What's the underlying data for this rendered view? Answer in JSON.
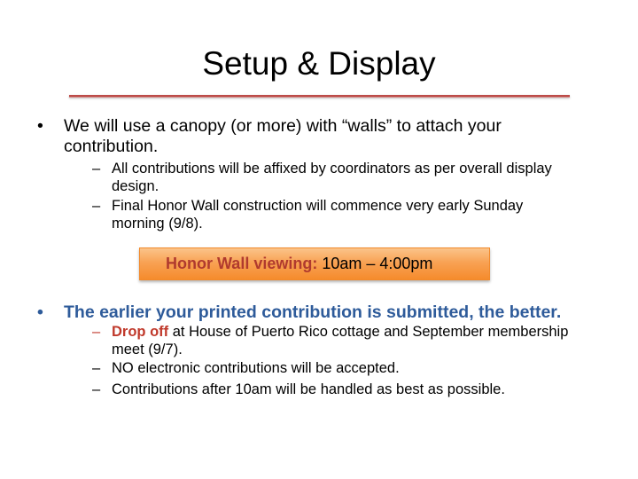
{
  "slide": {
    "title": "Setup & Display",
    "bullet_glyph": "•",
    "dash_glyph": "–",
    "items": [
      {
        "text_line1": "We will use a canopy (or more) with “walls” to attach your",
        "text_line2": "contribution."
      },
      {
        "text": "The earlier your printed contribution is submitted, the better."
      }
    ],
    "sub_items_1": [
      {
        "line1": "All contributions will be affixed by coordinators as per overall display",
        "line2": "design."
      },
      {
        "line1": "Final Honor Wall construction will commence very early Sunday",
        "line2": "morning (9/8)."
      }
    ],
    "callout": {
      "label": "Honor Wall viewing:",
      "value": " 10am – 4:00pm"
    },
    "sub_items_2": [
      {
        "highlight": "Drop off",
        "line1_rest": " at House of Puerto Rico cottage and September membership",
        "line2": "meet (9/7)."
      },
      {
        "text": "NO electronic contributions will be accepted."
      },
      {
        "text": "Contributions after 10am will be handled as best as possible."
      }
    ]
  },
  "colors": {
    "title_rule": "#c0504d",
    "blue_text": "#2e5b9a",
    "red_text": "#c0392b",
    "callout_fill": "#f8a254"
  }
}
